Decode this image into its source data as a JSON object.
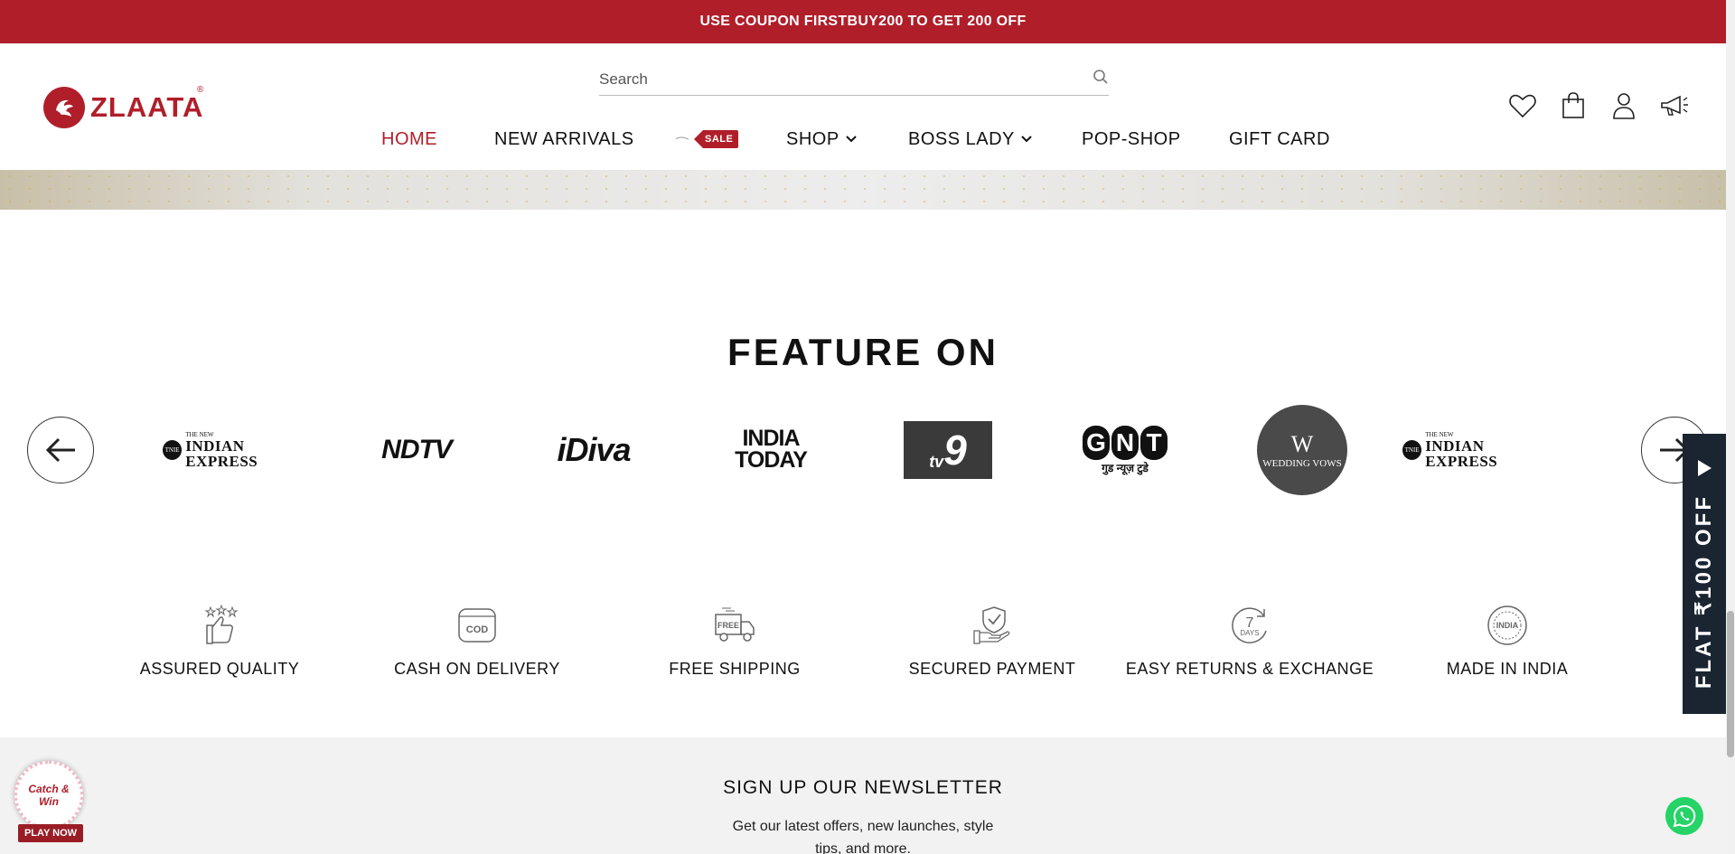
{
  "announcement": "USE COUPON FIRSTBUY200 TO GET 200 OFF",
  "logo": {
    "text": "ZLAATA",
    "reg": "®"
  },
  "search": {
    "placeholder": "Search"
  },
  "nav": [
    {
      "label": "HOME",
      "active": true
    },
    {
      "label": "NEW ARRIVALS"
    },
    {
      "label": "SALE"
    },
    {
      "label": "SHOP"
    },
    {
      "label": "BOSS LADY"
    },
    {
      "label": "POP-SHOP"
    },
    {
      "label": "GIFT CARD"
    }
  ],
  "header_icons": [
    "heart-icon",
    "bag-icon",
    "user-icon",
    "megaphone-icon"
  ],
  "featured": {
    "title": "FEATURE ON",
    "brands": [
      {
        "name": "INDIAN EXPRESS",
        "small": "THE NEW",
        "seal": "TNIE"
      },
      {
        "name": "NDTV"
      },
      {
        "name": "iDiva"
      },
      {
        "name_line1": "INDIA",
        "name_line2": "TODAY"
      },
      {
        "name": "9",
        "prefix": "tv"
      },
      {
        "name": "GNT",
        "sub": "गुड न्यूज़ टुडे"
      },
      {
        "name": "W",
        "sub": "WEDDING VOWS"
      },
      {
        "name": "INDIAN EXPRESS",
        "small": "THE NEW",
        "seal": "TNIE"
      }
    ]
  },
  "usps": [
    {
      "label": "ASSURED QUALITY",
      "icon": "thumbs-up-stars-icon"
    },
    {
      "label": "CASH ON DELIVERY",
      "icon": "cod-icon",
      "icon_text": "COD"
    },
    {
      "label": "FREE SHIPPING",
      "icon": "delivery-truck-icon",
      "icon_text": "FREE"
    },
    {
      "label": "SECURED PAYMENT",
      "icon": "shield-hand-icon"
    },
    {
      "label": "EASY RETURNS & EXCHANGE",
      "icon": "seven-days-icon",
      "icon_text": "7",
      "icon_sub": "DAYS"
    },
    {
      "label": "MADE IN INDIA",
      "icon": "india-seal-icon",
      "icon_text": "INDIA"
    }
  ],
  "newsletter": {
    "title": "SIGN UP OUR NEWSLETTER",
    "subtitle": "Get our latest offers, new launches, style tips, and more."
  },
  "side_offer": "FLAT ₹100 OFF",
  "catch_win": {
    "title": "Catch & Win",
    "cta": "PLAY NOW"
  },
  "colors": {
    "brand": "#b01e2a",
    "dark": "#1a2531",
    "whatsapp": "#25d366"
  }
}
